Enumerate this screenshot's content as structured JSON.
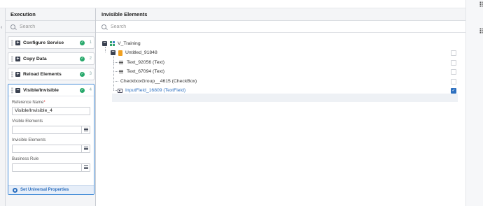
{
  "execution": {
    "title": "Execution",
    "search_placeholder": "Search",
    "steps": [
      {
        "label": "Configure Service",
        "number": "1"
      },
      {
        "label": "Copy Data",
        "number": "2"
      },
      {
        "label": "Reload Elements",
        "number": "3"
      }
    ],
    "active_step": {
      "label": "Visible/Invisible",
      "number": "4",
      "reference_name_label": "Reference Name",
      "reference_name_required": "*",
      "reference_name_value": "Visible/Invisible_4",
      "visible_elements_label": "Visible Elements",
      "visible_elements_value": "",
      "invisible_elements_label": "Invisible Elements",
      "invisible_elements_value": "",
      "business_rule_label": "Business Rule",
      "business_rule_value": "",
      "footer_label": "Set Universal Properties"
    }
  },
  "invisible_elements": {
    "title": "Invisible Elements",
    "search_placeholder": "Search",
    "tree": {
      "root": "V_Training",
      "child": "Untitled_91848",
      "items": [
        {
          "label": "Text_92056 (Text)",
          "checked": false
        },
        {
          "label": "Text_67094 (Text)",
          "checked": false
        },
        {
          "label": "CheckboxGroup__4615 (CheckBox)",
          "checked": false
        },
        {
          "label": "InputField_16809 (TextField)",
          "checked": true
        }
      ]
    }
  },
  "colors": {
    "accent": "#2c6fbf",
    "success": "#27a86b",
    "folder": "#f0a020"
  }
}
